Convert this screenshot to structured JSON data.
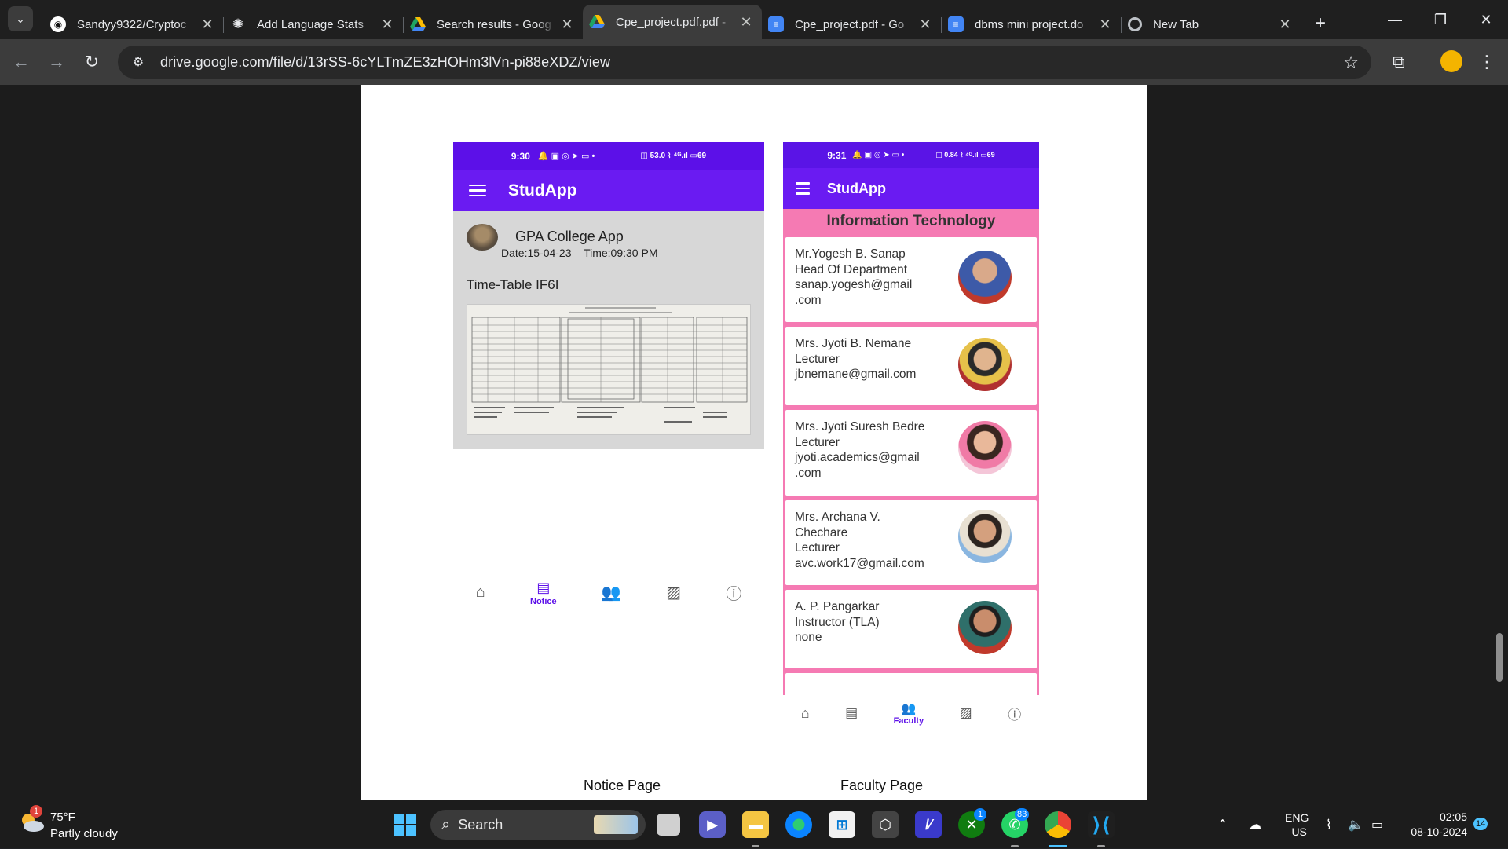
{
  "browser": {
    "tabs": [
      {
        "title": "Sandyy9322/Cryptoc",
        "icon": "github-icon",
        "active": false
      },
      {
        "title": "Add Language Stats",
        "icon": "openai-icon",
        "active": false
      },
      {
        "title": "Search results - Goog",
        "icon": "google-drive-icon",
        "active": false
      },
      {
        "title": "Cpe_project.pdf.pdf -",
        "icon": "google-drive-icon",
        "active": true
      },
      {
        "title": "Cpe_project.pdf - Go",
        "icon": "google-docs-icon",
        "active": false
      },
      {
        "title": "dbms mini project.do",
        "icon": "google-docs-icon",
        "active": false
      },
      {
        "title": "New Tab",
        "icon": "chrome-icon",
        "active": false
      }
    ],
    "url": "drive.google.com/file/d/13rSS-6cYLTmZE3zHOHm3lVn-pi88eXDZ/view"
  },
  "notice_phone": {
    "status_time": "9:30",
    "status_icons": "🔔 ▣ ◎ ➤ ▭ •",
    "status_right": "◫ 53.0 ⌇ ⁴ᴳ.ıl ▭69",
    "app_title": "StudApp",
    "notice_title": "GPA College App",
    "notice_date": "Date:15-04-23",
    "notice_time": "Time:09:30 PM",
    "notice_heading": "Time-Table IF6I",
    "nav": [
      {
        "icon": "home-icon",
        "label": ""
      },
      {
        "icon": "notice-icon",
        "label": "Notice",
        "active": true
      },
      {
        "icon": "faculty-icon",
        "label": ""
      },
      {
        "icon": "gallery-icon",
        "label": ""
      },
      {
        "icon": "info-icon",
        "label": ""
      }
    ],
    "caption": "Notice Page"
  },
  "faculty_phone": {
    "status_time": "9:31",
    "status_icons": "🔔 ▣ ◎ ➤ ▭ •",
    "status_right": "◫ 0.84 ⌇ ⁴ᴳ.ıl ▭69",
    "app_title": "StudApp",
    "department": "Information Technology",
    "faculty": [
      {
        "lines": [
          "Mr.Yogesh B. Sanap",
          "Head Of Department",
          "sanap.yogesh@gmail",
          ".com"
        ],
        "photo_color": "#c0392b"
      },
      {
        "lines": [
          "Mrs. Jyoti B. Nemane",
          "Lecturer",
          "jbnemane@gmail.com"
        ],
        "photo_color": "#b03030"
      },
      {
        "lines": [
          "Mrs. Jyoti Suresh Bedre",
          "Lecturer",
          "jyoti.academics@gmail",
          ".com"
        ],
        "photo_color": "#f4a6c6"
      },
      {
        "lines": [
          "Mrs. Archana V.",
          "Chechare",
          "Lecturer",
          "avc.work17@gmail.com"
        ],
        "photo_color": "#8ab6e0"
      },
      {
        "lines": [
          "A. P. Pangarkar",
          "Instructor (TLA)",
          "none"
        ],
        "photo_color": "#c0392b"
      }
    ],
    "nav": [
      {
        "icon": "home-icon",
        "label": ""
      },
      {
        "icon": "notice-icon",
        "label": ""
      },
      {
        "icon": "faculty-icon",
        "label": "Faculty",
        "active": true
      },
      {
        "icon": "gallery-icon",
        "label": ""
      },
      {
        "icon": "info-icon",
        "label": ""
      }
    ],
    "caption": "Faculty Page"
  },
  "taskbar": {
    "weather_temp": "75°F",
    "weather_desc": "Partly cloudy",
    "weather_badge": "1",
    "search_label": "Search",
    "xbox_badge": "1",
    "whatsapp_badge": "83",
    "lang_top": "ENG",
    "lang_bottom": "US",
    "time": "02:05",
    "date": "08-10-2024",
    "notification_count": "14"
  }
}
